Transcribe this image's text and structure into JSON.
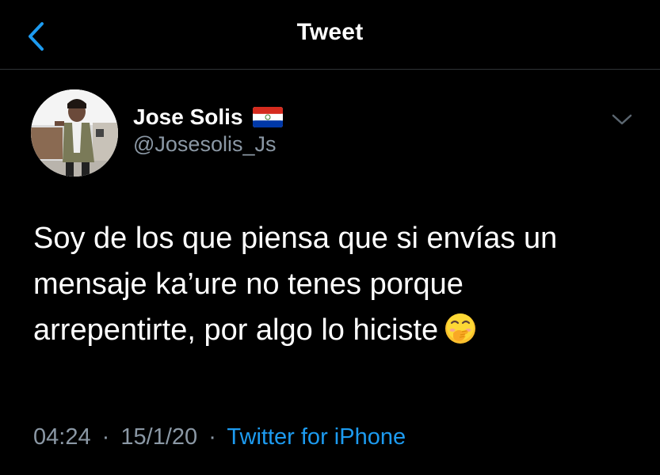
{
  "header": {
    "title": "Tweet",
    "back_icon": "chevron-left-icon",
    "accent_color": "#1d9bf0"
  },
  "author": {
    "display_name": "Jose Solis",
    "handle": "@Josesolis_Js",
    "flag_icon": "paraguay-flag-icon",
    "more_icon": "chevron-down-icon"
  },
  "tweet": {
    "lines": [
      "Soy de los que piensa que si envías un",
      "mensaje ka’ure no tenes porque",
      "arrepentirte, por algo lo hiciste"
    ],
    "emoji_icon": "face-with-hand-over-mouth-emoji"
  },
  "meta": {
    "time": "04:24",
    "separator": "·",
    "date": "15/1/20",
    "source": "Twitter for iPhone"
  },
  "colors": {
    "background": "#000000",
    "text": "#ffffff",
    "secondary_text": "#8b98a5",
    "link": "#1d9bf0",
    "divider": "#2f3336"
  }
}
